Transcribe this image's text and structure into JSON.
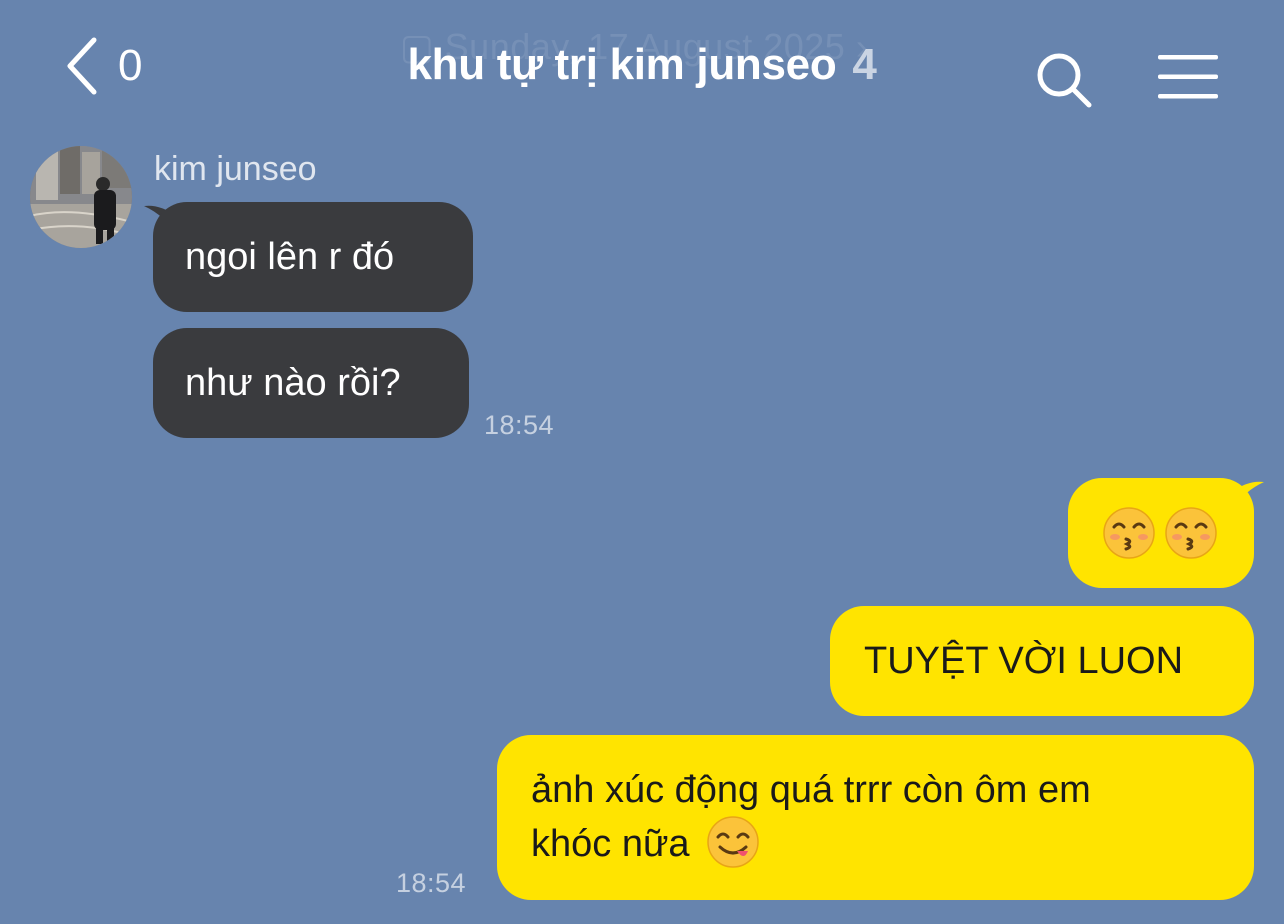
{
  "ghost_date": "Sunday, 17 August 2025",
  "header": {
    "back_count": "0",
    "title": "khu tự trị kim junseo",
    "member_count": "4",
    "back_icon": "chevron-left-icon",
    "search_icon": "search-icon",
    "menu_icon": "hamburger-menu-icon"
  },
  "conversation": {
    "sender_name": "kim junseo",
    "incoming": [
      {
        "text": "ngoi lên r đó"
      },
      {
        "text": "như nào rồi?"
      }
    ],
    "incoming_time": "18:54",
    "outgoing": [
      {
        "emoji": [
          "kissing-face-smiling-eyes",
          "kissing-face-smiling-eyes"
        ]
      },
      {
        "text": "TUYỆT VỜI LUON"
      },
      {
        "line1": "ảnh xúc động quá trrr còn ôm em",
        "line2": "khóc nữa",
        "emoji": "face-savoring-food"
      }
    ],
    "outgoing_time": "18:54"
  },
  "colors": {
    "background": "#6784AE",
    "incoming_bubble": "#3A3B3E",
    "outgoing_bubble": "#FFE400"
  }
}
